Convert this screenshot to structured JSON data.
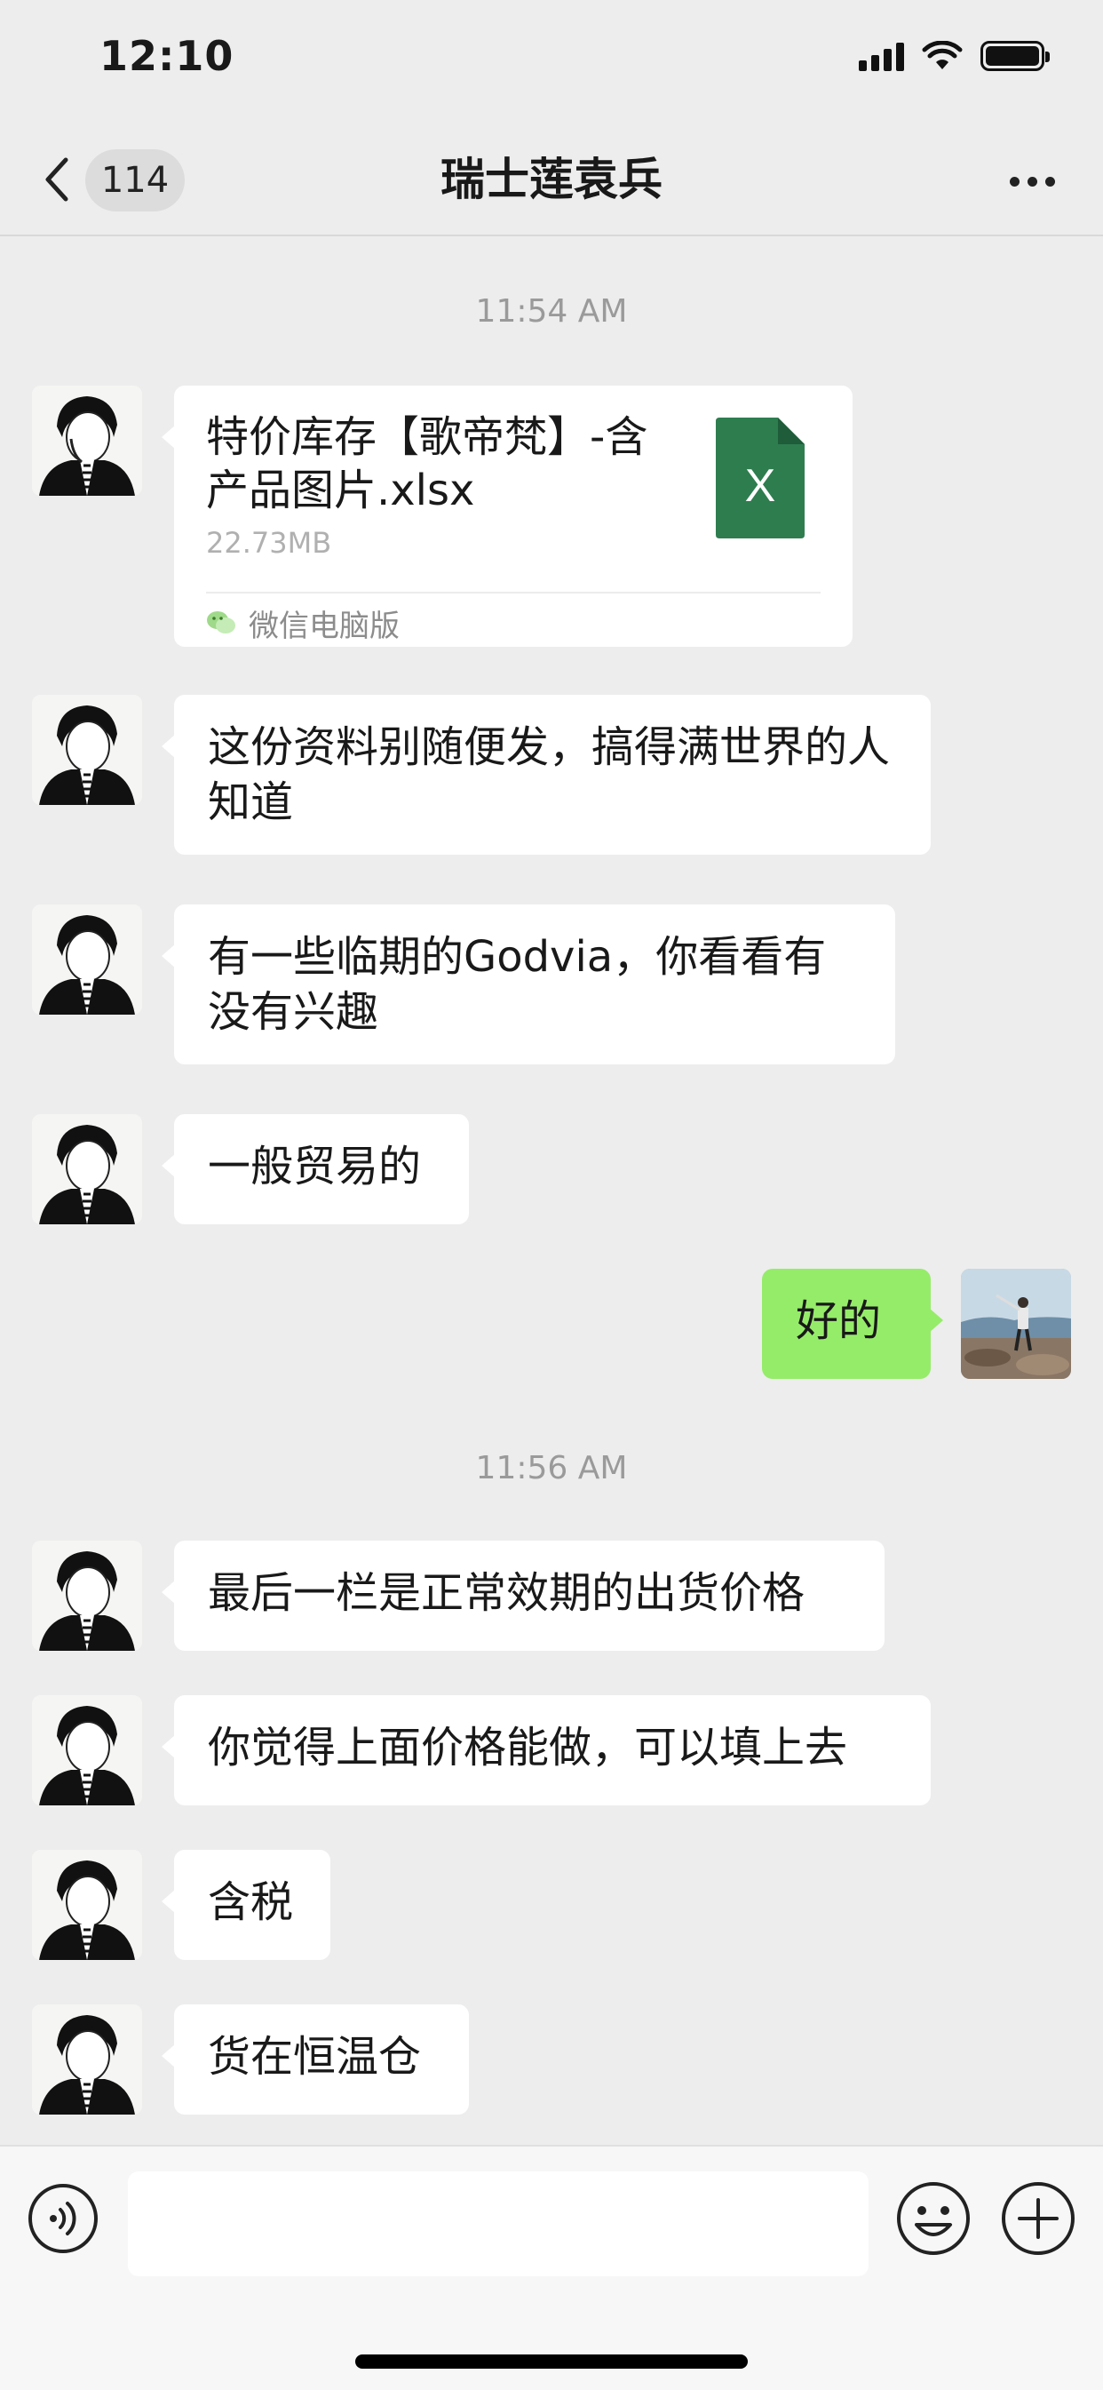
{
  "status_bar": {
    "time": "12:10"
  },
  "header": {
    "badge_count": "114",
    "title": "瑞士莲袁兵"
  },
  "timestamps": [
    "11:54 AM",
    "11:56 AM"
  ],
  "file_message": {
    "name": "特价库存【歌帝梵】-含产品图片.xlsx",
    "size": "22.73MB",
    "source": "微信电脑版",
    "icon_letter": "X",
    "icon_color": "#2e7d4f"
  },
  "messages": [
    {
      "text": "这份资料别随便发，搞得满世界的人知道",
      "from": "other"
    },
    {
      "text": "有一些临期的Godvia，你看看有没有兴趣",
      "from": "other"
    },
    {
      "text": "一般贸易的",
      "from": "other"
    },
    {
      "text": "好的",
      "from": "me"
    },
    {
      "text": "最后一栏是正常效期的出货价格",
      "from": "other"
    },
    {
      "text": "你觉得上面价格能做，可以填上去",
      "from": "other"
    },
    {
      "text": "含税",
      "from": "other"
    },
    {
      "text": "货在恒温仓",
      "from": "other"
    }
  ],
  "icons": {
    "back": "chevron-left-icon",
    "more": "more-dots-icon",
    "voice": "voice-icon",
    "emoji": "emoji-icon",
    "plus": "plus-icon"
  },
  "colors": {
    "background": "#ededed",
    "bubble_me": "#95ec69",
    "bubble_other": "#ffffff",
    "excel_green": "#2e7d4f"
  }
}
